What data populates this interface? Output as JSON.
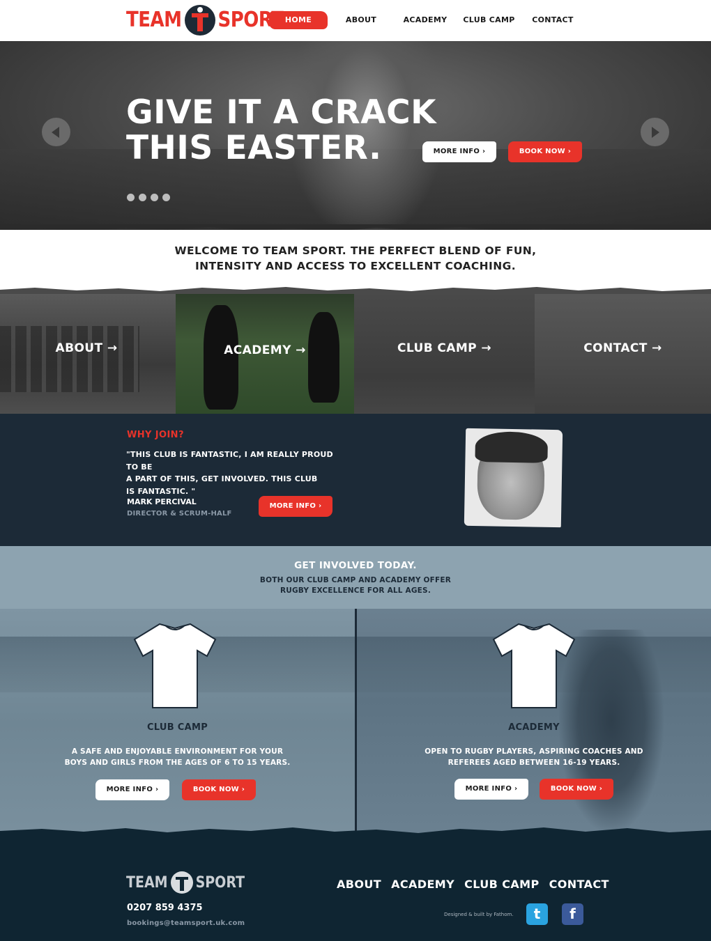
{
  "nav": {
    "logo_left": "TEAM",
    "logo_right": "SPORT",
    "items": [
      {
        "label": "HOME",
        "active": true
      },
      {
        "label": "ABOUT",
        "active": false
      },
      {
        "label": "ACADEMY",
        "active": false
      },
      {
        "label": "CLUB CAMP",
        "active": false
      },
      {
        "label": "CONTACT",
        "active": false
      }
    ]
  },
  "hero": {
    "headline_line1": "GIVE IT A CRACK",
    "headline_line2": "THIS EASTER.",
    "more_info_label": "MORE INFO ›",
    "book_now_label": "BOOK NOW ›",
    "slide_count": 4
  },
  "welcome": {
    "line1": "WELCOME TO TEAM SPORT. THE PERFECT BLEND OF FUN,",
    "line2": "INTENSITY AND ACCESS TO EXCELLENT COACHING."
  },
  "tiles": [
    {
      "label": "ABOUT →"
    },
    {
      "label": "ACADEMY →"
    },
    {
      "label": "CLUB CAMP →"
    },
    {
      "label": "CONTACT →"
    }
  ],
  "why_join": {
    "heading": "WHY JOIN?",
    "quote_line1": "\"THIS CLUB IS FANTASTIC, I AM REALLY PROUD TO BE",
    "quote_line2": "A PART OF THIS, GET INVOLVED. THIS CLUB",
    "quote_line3": "IS FANTASTIC. \"",
    "name": "MARK PERCIVAL",
    "role": "DIRECTOR & SCRUM-HALF",
    "more_info_label": "MORE INFO ›"
  },
  "get_involved": {
    "heading": "GET INVOLVED TODAY.",
    "line1": "BOTH OUR CLUB CAMP AND ACADEMY OFFER",
    "line2": "RUGBY EXCELLENCE FOR ALL AGES."
  },
  "programs": {
    "club_camp": {
      "title": "CLUB CAMP",
      "desc_line1": "A SAFE AND ENJOYABLE ENVIRONMENT FOR YOUR",
      "desc_line2": "BOYS AND GIRLS FROM THE AGES OF 6 TO 15 YEARS.",
      "more_info_label": "MORE INFO ›",
      "book_now_label": "BOOK NOW ›"
    },
    "academy": {
      "title": "ACADEMY",
      "desc_line1": "OPEN TO RUGBY PLAYERS, ASPIRING COACHES AND",
      "desc_line2": "REFEREES AGED BETWEEN 16-19 YEARS.",
      "more_info_label": "MORE INFO ›",
      "book_now_label": "BOOK NOW ›"
    }
  },
  "footer": {
    "logo_left": "TEAM",
    "logo_right": "SPORT",
    "phone": "0207 859 4375",
    "email": "bookings@teamsport.uk.com",
    "links": [
      "ABOUT",
      "ACADEMY",
      "CLUB CAMP",
      "CONTACT"
    ],
    "credit": "Designed & built by Fathom.",
    "twitter_icon": "twitter-icon",
    "facebook_icon": "facebook-icon"
  },
  "colors": {
    "brand_red": "#e8332a",
    "navy": "#1c2a37",
    "steel_blue": "#8da3b0",
    "footer_navy": "#0f2532"
  }
}
